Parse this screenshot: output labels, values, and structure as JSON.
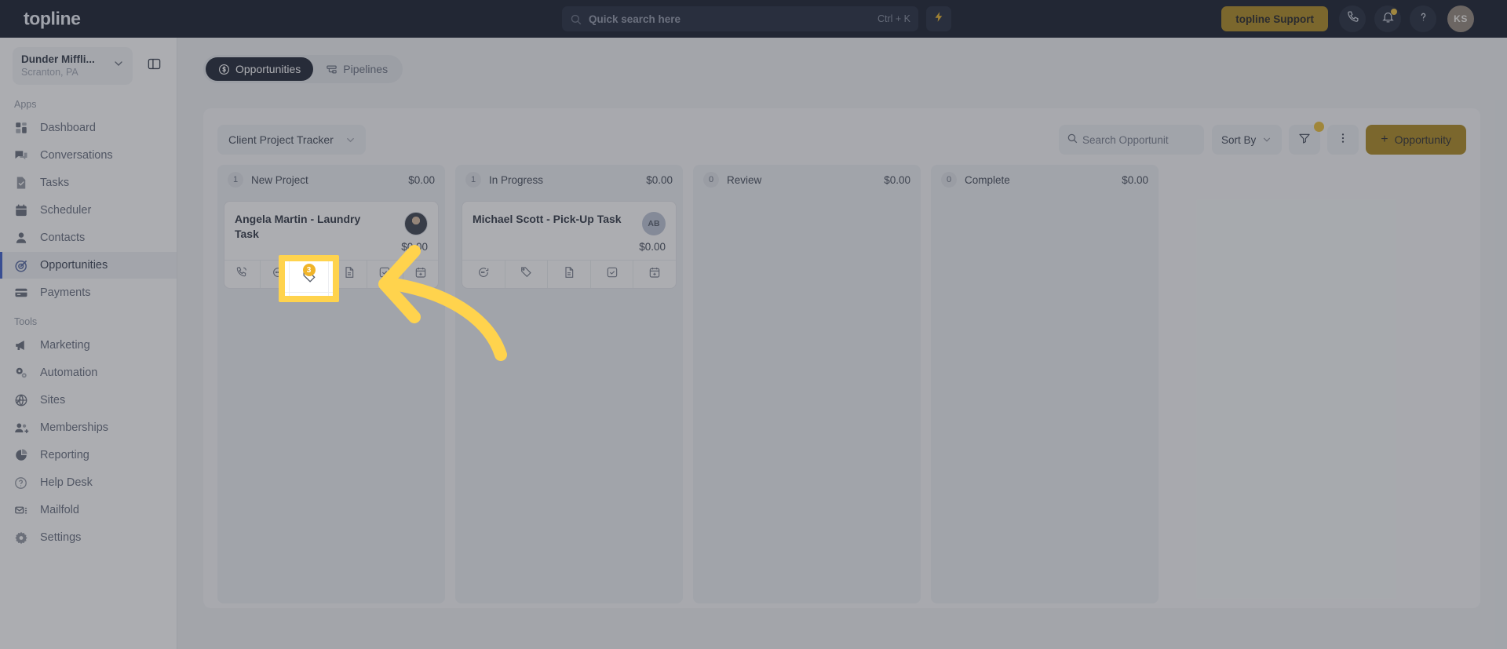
{
  "topnav": {
    "brand": "topline",
    "search": {
      "placeholder": "Quick search here",
      "shortcut": "Ctrl + K",
      "icon": "search-icon"
    },
    "bolt_icon": "lightning-bolt-icon",
    "support_label": "topline Support",
    "icons": [
      "phone-icon",
      "bell-icon",
      "help-icon"
    ],
    "avatar_initials": "KS",
    "accent": "#a6800f",
    "background": "#040b1d"
  },
  "sidebar": {
    "org_name": "Dunder Miffli...",
    "org_location": "Scranton, PA",
    "panel_toggle_icon": "panel-toggle-icon",
    "sections": [
      {
        "label": "Apps",
        "items": [
          {
            "label": "Dashboard",
            "icon": "dashboard-icon",
            "active": false
          },
          {
            "label": "Conversations",
            "icon": "chat-bubbles-icon",
            "active": false
          },
          {
            "label": "Tasks",
            "icon": "task-check-icon",
            "active": false
          },
          {
            "label": "Scheduler",
            "icon": "calendar-icon",
            "active": false
          },
          {
            "label": "Contacts",
            "icon": "person-icon",
            "active": false
          },
          {
            "label": "Opportunities",
            "icon": "target-icon",
            "active": true
          },
          {
            "label": "Payments",
            "icon": "credit-card-icon",
            "active": false
          }
        ]
      },
      {
        "label": "Tools",
        "items": [
          {
            "label": "Marketing",
            "icon": "megaphone-icon",
            "active": false
          },
          {
            "label": "Automation",
            "icon": "gears-icon",
            "active": false
          },
          {
            "label": "Sites",
            "icon": "globe-icon",
            "active": false
          },
          {
            "label": "Memberships",
            "icon": "people-plus-icon",
            "active": false
          },
          {
            "label": "Reporting",
            "icon": "pie-chart-icon",
            "active": false
          },
          {
            "label": "Help Desk",
            "icon": "help-circle-icon",
            "active": false
          },
          {
            "label": "Mailfold",
            "icon": "mail-stack-icon",
            "active": false
          },
          {
            "label": "Settings",
            "icon": "gear-icon",
            "active": false
          }
        ]
      }
    ]
  },
  "tabs": [
    {
      "label": "Opportunities",
      "icon": "dollar-circle-icon",
      "active": true
    },
    {
      "label": "Pipelines",
      "icon": "pipeline-icon",
      "active": false
    }
  ],
  "toolbar": {
    "pipeline_selected": "Client Project Tracker",
    "pipeline_chevron": "chevron-down-icon",
    "search_placeholder": "Search Opportunit",
    "search_icon": "search-icon",
    "sort_label": "Sort By",
    "sort_chevron": "chevron-down-icon",
    "filter_icon": "funnel-filter-icon",
    "filter_badge": true,
    "more_icon": "more-vertical-icon",
    "add_label": "Opportunity",
    "add_plus": "+"
  },
  "board": {
    "columns": [
      {
        "count": "1",
        "name": "New Project",
        "value": "$0.00",
        "cards": [
          {
            "title": "Angela Martin - Laundry Task",
            "amount": "$0.00",
            "avatar_type": "photo",
            "avatar_initials": "",
            "actions": [
              {
                "icon": "phone-call-icon",
                "badge": ""
              },
              {
                "icon": "chat-bubble-icon",
                "badge": ""
              },
              {
                "icon": "tag-icon",
                "badge": "3"
              },
              {
                "icon": "document-icon",
                "badge": ""
              },
              {
                "icon": "task-check-icon",
                "badge": ""
              },
              {
                "icon": "calendar-add-icon",
                "badge": ""
              }
            ]
          }
        ]
      },
      {
        "count": "1",
        "name": "In Progress",
        "value": "$0.00",
        "cards": [
          {
            "title": "Michael Scott - Pick-Up Task",
            "amount": "$0.00",
            "avatar_type": "initials",
            "avatar_initials": "AB",
            "actions": [
              {
                "icon": "chat-bubble-icon",
                "badge": ""
              },
              {
                "icon": "tag-icon",
                "badge": ""
              },
              {
                "icon": "document-icon",
                "badge": ""
              },
              {
                "icon": "task-check-icon",
                "badge": ""
              },
              {
                "icon": "calendar-add-icon",
                "badge": ""
              }
            ]
          }
        ]
      },
      {
        "count": "0",
        "name": "Review",
        "value": "$0.00",
        "cards": []
      },
      {
        "count": "0",
        "name": "Complete",
        "value": "$0.00",
        "cards": []
      }
    ]
  },
  "annotation": {
    "highlight_target_icon": "tag-icon",
    "highlight_badge": "3",
    "highlight_color": "#ffd34d",
    "arrow_color": "#ffd34d",
    "arrow_direction": "points-left"
  }
}
